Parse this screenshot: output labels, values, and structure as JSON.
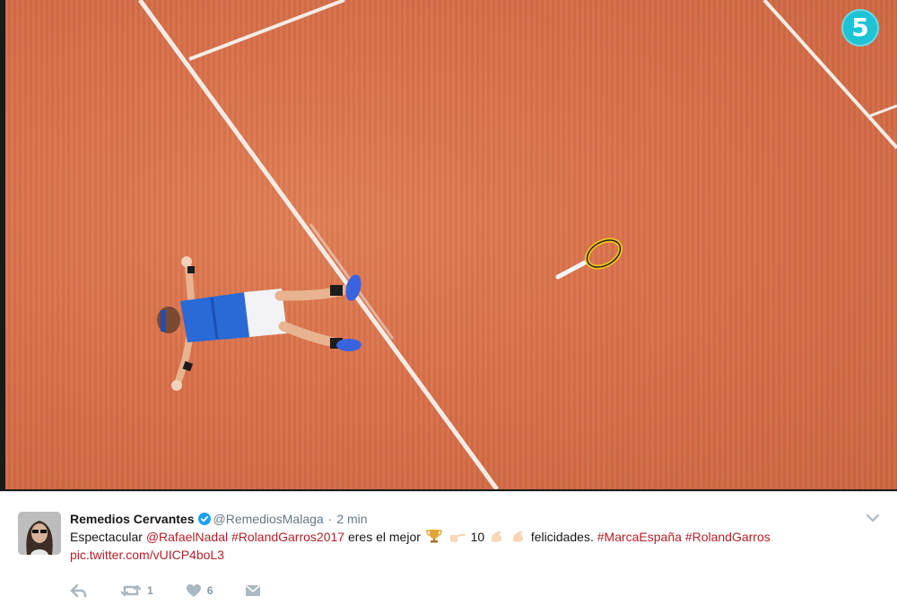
{
  "media": {
    "channel_logo": "5",
    "scene": "tennis-player-lying-on-clay-court"
  },
  "tweet": {
    "author_name": "Remedios Cervantes",
    "author_handle": "@RemediosMalaga",
    "separator": "·",
    "timestamp": "2 min",
    "text_intro": "Espectacular",
    "mention": "@RafaelNadal",
    "hashtag_1": "#RolandGarros2017",
    "text_mid": "eres el mejor",
    "number": "10",
    "text_end": "felicidades.",
    "hashtag_2": "#MarcaEspaña",
    "hashtag_3": "#RolandGarros",
    "pic_link": "pic.twitter.com/vUICP4boL3",
    "retweet_count": "1",
    "like_count": "6"
  },
  "icons": {
    "verified": "verified-badge-icon",
    "more": "chevron-down-icon",
    "reply": "reply-icon",
    "retweet": "retweet-icon",
    "like": "heart-icon",
    "dm": "envelope-icon",
    "trophy": "trophy-emoji",
    "pointing": "pointing-hand-emoji",
    "muscle": "flexed-biceps-emoji"
  },
  "colors": {
    "clay": "#d9704a",
    "link": "#b5202a",
    "verified": "#1da1f2",
    "channel_logo": "#1fc3d6",
    "action_icon": "#aab8c2"
  }
}
